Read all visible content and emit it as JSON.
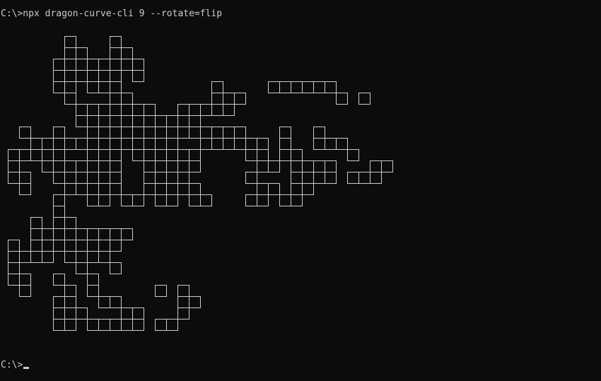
{
  "terminal": {
    "command_line": "C:\\>npx dragon-curve-cli 9 --rotate=flip",
    "prompt": "C:\\>",
    "colors": {
      "background": "#0c0c0c",
      "foreground": "#cccccc"
    }
  }
}
